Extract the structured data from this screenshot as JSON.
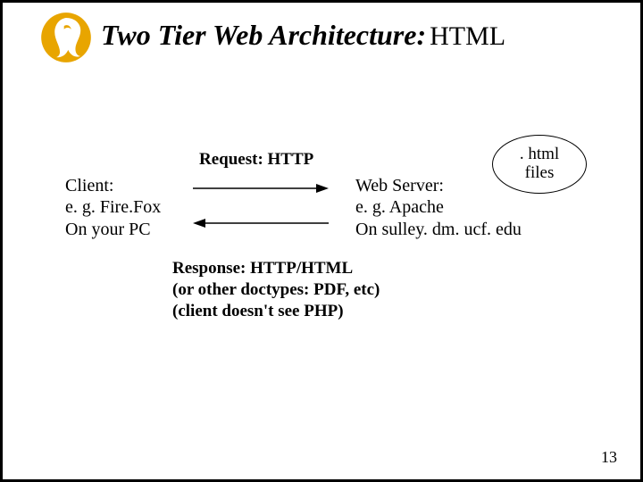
{
  "title_main": "Two Tier Web Architecture:",
  "title_sub": "HTML",
  "client": {
    "line1": "Client:",
    "line2": "e. g. Fire.Fox",
    "line3": "On your PC"
  },
  "request_label": "Request: HTTP",
  "server": {
    "line1": "Web Server:",
    "line2": "e. g. Apache",
    "line3": "On sulley. dm. ucf. edu"
  },
  "files": {
    "line1": ". html",
    "line2": "files"
  },
  "response": {
    "line1": "Response: HTTP/HTML",
    "line2": "(or other doctypes: PDF, etc)",
    "line3": "(client doesn't see PHP)"
  },
  "page_number": "13",
  "logo_name": "ucf-pegasus-logo"
}
